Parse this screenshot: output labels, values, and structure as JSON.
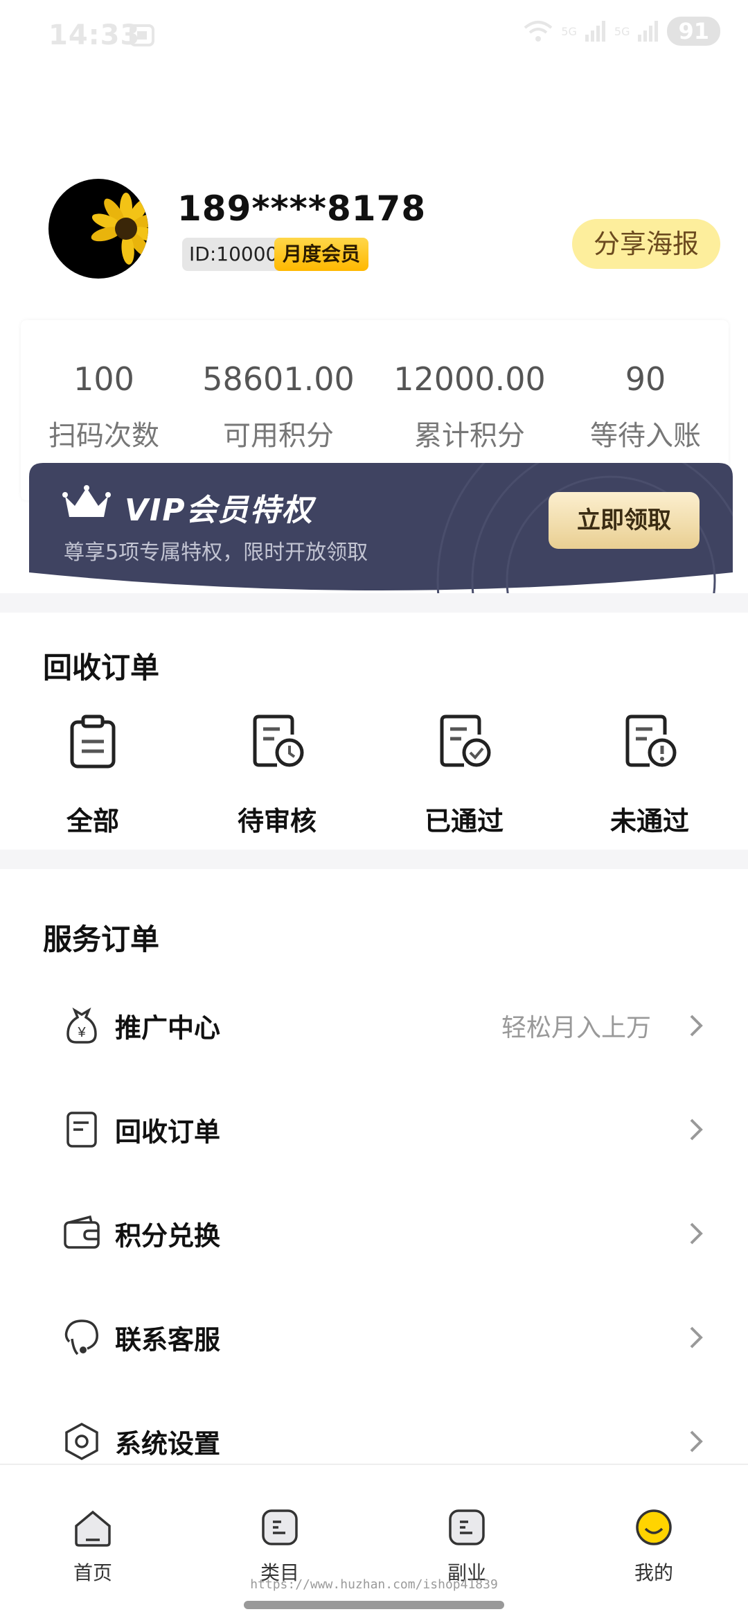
{
  "status_bar": {
    "time": "14:33",
    "battery": "91",
    "net1": "5G",
    "net2": "5G"
  },
  "profile": {
    "phone": "189****8178",
    "id_label": "ID:10000",
    "member_label": "月度会员",
    "share_button": "分享海报"
  },
  "stats": [
    {
      "value": "100",
      "label": "扫码次数"
    },
    {
      "value": "58601.00",
      "label": "可用积分"
    },
    {
      "value": "12000.00",
      "label": "累计积分"
    },
    {
      "value": "90",
      "label": "等待入账"
    }
  ],
  "vip_banner": {
    "title": "VIP会员特权",
    "subtitle": "尊享5项专属特权，限时开放领取",
    "button": "立即领取"
  },
  "recycle_orders": {
    "title": "回收订单",
    "items": [
      {
        "label": "全部",
        "icon": "clipboard-icon"
      },
      {
        "label": "待审核",
        "icon": "document-clock-icon"
      },
      {
        "label": "已通过",
        "icon": "document-check-icon"
      },
      {
        "label": "未通过",
        "icon": "document-alert-icon"
      }
    ]
  },
  "service_orders": {
    "title": "服务订单",
    "items": [
      {
        "label": "推广中心",
        "hint": "轻松月入上万",
        "icon": "money-bag-icon"
      },
      {
        "label": "回收订单",
        "hint": "",
        "icon": "document-icon"
      },
      {
        "label": "积分兑换",
        "hint": "",
        "icon": "wallet-icon"
      },
      {
        "label": "联系客服",
        "hint": "",
        "icon": "headset-icon"
      },
      {
        "label": "系统设置",
        "hint": "",
        "icon": "settings-hexagon-icon"
      }
    ]
  },
  "bottom_nav": {
    "items": [
      {
        "label": "首页",
        "icon": "home-icon"
      },
      {
        "label": "类目",
        "icon": "category-icon"
      },
      {
        "label": "副业",
        "icon": "side-job-icon"
      },
      {
        "label": "我的",
        "icon": "profile-smile-icon"
      }
    ],
    "active_index": 3
  },
  "watermark": "https://www.huzhan.com/ishop41839",
  "colors": {
    "accent_yellow": "#ffd400",
    "vip_banner": "#3f4361",
    "share_bg": "#fdee9c"
  }
}
